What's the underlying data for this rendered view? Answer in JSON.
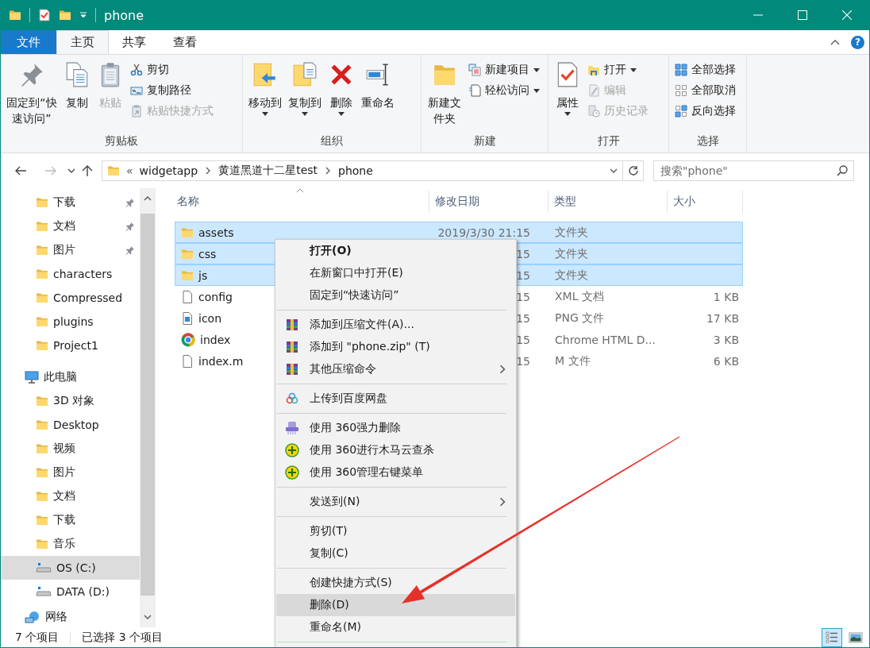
{
  "window": {
    "title": "phone"
  },
  "ribbon_tabs": [
    {
      "label": "文件",
      "kind": "file",
      "selected": false
    },
    {
      "label": "主页",
      "kind": "tab",
      "selected": true
    },
    {
      "label": "共享",
      "kind": "tab",
      "selected": false
    },
    {
      "label": "查看",
      "kind": "tab",
      "selected": false
    }
  ],
  "help_button": "?",
  "ribbon": {
    "groups": [
      {
        "label": "剪贴板",
        "buttons": [
          {
            "kind": "large",
            "label": "固定到“快速访问”",
            "disabled": false,
            "dropdown": false
          },
          {
            "kind": "large",
            "label": "复制",
            "disabled": false,
            "dropdown": false
          },
          {
            "kind": "large",
            "label": "粘贴",
            "disabled": true,
            "dropdown": false
          },
          {
            "kind": "small",
            "label": "剪切",
            "disabled": false,
            "dropdown": false
          },
          {
            "kind": "small",
            "label": "复制路径",
            "disabled": false,
            "dropdown": false
          },
          {
            "kind": "small",
            "label": "粘贴快捷方式",
            "disabled": true,
            "dropdown": false
          }
        ]
      },
      {
        "label": "组织",
        "buttons": [
          {
            "kind": "large",
            "label": "移动到",
            "disabled": false,
            "dropdown": true
          },
          {
            "kind": "large",
            "label": "复制到",
            "disabled": false,
            "dropdown": true
          },
          {
            "kind": "large",
            "label": "删除",
            "disabled": false,
            "dropdown": true
          },
          {
            "kind": "large",
            "label": "重命名",
            "disabled": false,
            "dropdown": false
          }
        ]
      },
      {
        "label": "新建",
        "buttons": [
          {
            "kind": "large",
            "label": "新建文件夹",
            "disabled": false,
            "dropdown": false
          },
          {
            "kind": "small",
            "label": "新建项目",
            "disabled": false,
            "dropdown": true
          },
          {
            "kind": "small",
            "label": "轻松访问",
            "disabled": false,
            "dropdown": true
          }
        ]
      },
      {
        "label": "打开",
        "buttons": [
          {
            "kind": "large",
            "label": "属性",
            "disabled": false,
            "dropdown": true
          },
          {
            "kind": "small",
            "label": "打开",
            "disabled": false,
            "dropdown": true
          },
          {
            "kind": "small",
            "label": "编辑",
            "disabled": true,
            "dropdown": false
          },
          {
            "kind": "small",
            "label": "历史记录",
            "disabled": true,
            "dropdown": false
          }
        ]
      },
      {
        "label": "选择",
        "buttons": [
          {
            "kind": "small",
            "label": "全部选择",
            "disabled": false,
            "dropdown": false
          },
          {
            "kind": "small",
            "label": "全部取消",
            "disabled": false,
            "dropdown": false
          },
          {
            "kind": "small",
            "label": "反向选择",
            "disabled": false,
            "dropdown": false
          }
        ]
      }
    ]
  },
  "address": {
    "overflow": "«",
    "crumbs": [
      "widgetapp",
      "黄道黑道十二星test",
      "phone"
    ]
  },
  "search": {
    "placeholder": "搜索\"phone\""
  },
  "sidebar": {
    "quick_access": [
      {
        "label": "下载",
        "kind": "folder",
        "pinned": true,
        "selected": false
      },
      {
        "label": "文档",
        "kind": "folder",
        "pinned": true,
        "selected": false
      },
      {
        "label": "图片",
        "kind": "folder",
        "pinned": true,
        "selected": false
      },
      {
        "label": "characters",
        "kind": "folder",
        "pinned": false,
        "selected": false
      },
      {
        "label": "Compressed",
        "kind": "folder",
        "pinned": false,
        "selected": false
      },
      {
        "label": "plugins",
        "kind": "folder",
        "pinned": false,
        "selected": false
      },
      {
        "label": "Project1",
        "kind": "folder",
        "pinned": false,
        "selected": false
      }
    ],
    "tree": [
      {
        "label": "此电脑",
        "kind": "computer",
        "selected": false,
        "children": [
          {
            "label": "3D 对象",
            "kind": "folder",
            "selected": false
          },
          {
            "label": "Desktop",
            "kind": "folder",
            "selected": false
          },
          {
            "label": "视频",
            "kind": "folder",
            "selected": false
          },
          {
            "label": "图片",
            "kind": "folder",
            "selected": false
          },
          {
            "label": "文档",
            "kind": "folder",
            "selected": false
          },
          {
            "label": "下载",
            "kind": "folder",
            "selected": false
          },
          {
            "label": "音乐",
            "kind": "folder",
            "selected": false
          },
          {
            "label": "OS (C:)",
            "kind": "drive",
            "selected": true
          },
          {
            "label": "DATA (D:)",
            "kind": "drive",
            "selected": false
          }
        ]
      },
      {
        "label": "网络",
        "kind": "network",
        "selected": false
      }
    ]
  },
  "file_list": {
    "columns": [
      "名称",
      "修改日期",
      "类型",
      "大小"
    ],
    "rows": [
      {
        "name": "assets",
        "kind": "folder",
        "date": "2019/3/30 21:15",
        "type": "文件夹",
        "selected": true
      },
      {
        "name": "css",
        "kind": "folder",
        "date": "15",
        "type": "文件夹",
        "selected": true
      },
      {
        "name": "js",
        "kind": "folder",
        "date": "15",
        "type": "文件夹",
        "selected": true
      },
      {
        "name": "config",
        "kind": "file",
        "date": "15",
        "type": "XML 文档",
        "size": "1 KB",
        "selected": false
      },
      {
        "name": "icon",
        "kind": "image",
        "date": "15",
        "type": "PNG 文件",
        "size": "17 KB",
        "selected": false
      },
      {
        "name": "index",
        "kind": "web",
        "date": "15",
        "type": "Chrome HTML D...",
        "size": "3 KB",
        "selected": false
      },
      {
        "name": "index.m",
        "kind": "file",
        "date": "15",
        "type": "M 文件",
        "size": "6 KB",
        "selected": false
      }
    ]
  },
  "context_menu": {
    "items": [
      {
        "kind": "item",
        "label": "打开(O)",
        "default": true,
        "submenu": false,
        "selected": false
      },
      {
        "kind": "item",
        "label": "在新窗口中打开(E)",
        "default": false,
        "submenu": false,
        "selected": false
      },
      {
        "kind": "item",
        "label": "固定到“快速访问”",
        "default": false,
        "submenu": false,
        "selected": false
      },
      {
        "kind": "separator"
      },
      {
        "kind": "item",
        "label": "添加到压缩文件(A)...",
        "default": false,
        "submenu": false,
        "selected": false
      },
      {
        "kind": "item",
        "label": "添加到 \"phone.zip\" (T)",
        "default": false,
        "submenu": false,
        "selected": false
      },
      {
        "kind": "item",
        "label": "其他压缩命令",
        "default": false,
        "submenu": true,
        "selected": false
      },
      {
        "kind": "separator"
      },
      {
        "kind": "item",
        "label": "上传到百度网盘",
        "default": false,
        "submenu": false,
        "selected": false
      },
      {
        "kind": "separator"
      },
      {
        "kind": "item",
        "label": "使用 360强力删除",
        "default": false,
        "submenu": false,
        "selected": false
      },
      {
        "kind": "item",
        "label": "使用 360进行木马云查杀",
        "default": false,
        "submenu": false,
        "selected": false
      },
      {
        "kind": "item",
        "label": "使用 360管理右键菜单",
        "default": false,
        "submenu": false,
        "selected": false
      },
      {
        "kind": "separator"
      },
      {
        "kind": "item",
        "label": "发送到(N)",
        "default": false,
        "submenu": true,
        "selected": false
      },
      {
        "kind": "separator"
      },
      {
        "kind": "item",
        "label": "剪切(T)",
        "default": false,
        "submenu": false,
        "selected": false
      },
      {
        "kind": "item",
        "label": "复制(C)",
        "default": false,
        "submenu": false,
        "selected": false
      },
      {
        "kind": "separator"
      },
      {
        "kind": "item",
        "label": "创建快捷方式(S)",
        "default": false,
        "submenu": false,
        "selected": false
      },
      {
        "kind": "item",
        "label": "删除(D)",
        "default": false,
        "submenu": false,
        "selected": true
      },
      {
        "kind": "item",
        "label": "重命名(M)",
        "default": false,
        "submenu": false,
        "selected": false
      },
      {
        "kind": "separator"
      }
    ]
  },
  "status_bar": {
    "item_count": "7 个项目",
    "selection": "已选择 3 个项目",
    "views": [
      {
        "kind": "details",
        "selected": true
      },
      {
        "kind": "tiles",
        "selected": false
      }
    ]
  }
}
